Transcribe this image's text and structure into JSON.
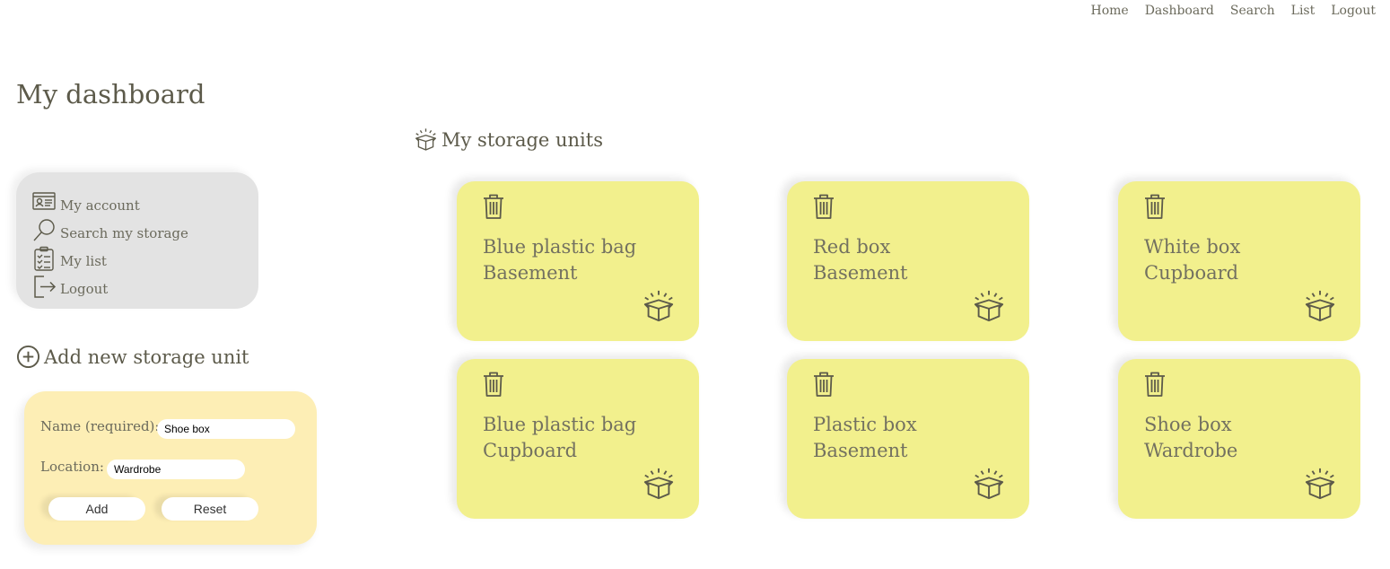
{
  "nav": {
    "home": "Home",
    "dashboard": "Dashboard",
    "search": "Search",
    "list": "List",
    "logout": "Logout"
  },
  "page_title": "My dashboard",
  "menu": {
    "items": [
      {
        "label": "My account",
        "icon": "account-card-icon"
      },
      {
        "label": "Search my storage",
        "icon": "magnifier-icon"
      },
      {
        "label": "My list",
        "icon": "clipboard-list-icon"
      },
      {
        "label": "Logout",
        "icon": "logout-icon"
      }
    ]
  },
  "add_form": {
    "heading": "Add new storage unit",
    "name_label": "Name (required):",
    "name_value": "Shoe box",
    "location_label": "Location:",
    "location_value": "Wardrobe",
    "add_label": "Add",
    "reset_label": "Reset"
  },
  "units_heading": "My storage units",
  "units": [
    {
      "name": "Blue plastic bag",
      "location": "Basement"
    },
    {
      "name": "Red box",
      "location": "Basement"
    },
    {
      "name": "White box",
      "location": "Cupboard"
    },
    {
      "name": "Blue plastic bag",
      "location": "Cupboard"
    },
    {
      "name": "Plastic box",
      "location": "Basement"
    },
    {
      "name": "Shoe box",
      "location": "Wardrobe"
    }
  ],
  "colors": {
    "card": "#f2f08d",
    "menu": "#e3e3e3",
    "form": "#fdeeb5",
    "text": "#5c5a4a"
  }
}
